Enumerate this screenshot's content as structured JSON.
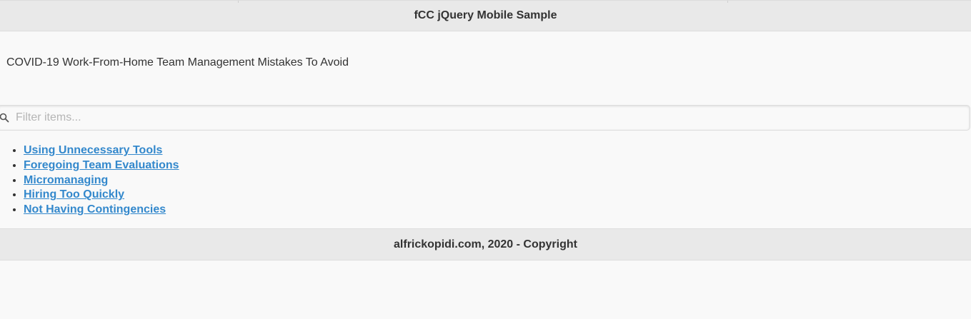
{
  "header": {
    "title": "fCC jQuery Mobile Sample"
  },
  "content": {
    "heading": "COVID-19 Work-From-Home Team Management Mistakes To Avoid"
  },
  "filter": {
    "placeholder": "Filter items...",
    "icon": "search-icon"
  },
  "list": {
    "items": [
      {
        "label": "Using Unnecessary Tools"
      },
      {
        "label": "Foregoing Team Evaluations"
      },
      {
        "label": "Micromanaging"
      },
      {
        "label": "Hiring Too Quickly"
      },
      {
        "label": "Not Having Contingencies"
      }
    ]
  },
  "footer": {
    "text": "alfrickopidi.com, 2020 - Copyright"
  },
  "colors": {
    "bar_background": "#e9e9e9",
    "page_background": "#f9f9f9",
    "link": "#3388cc",
    "text": "#333333"
  }
}
